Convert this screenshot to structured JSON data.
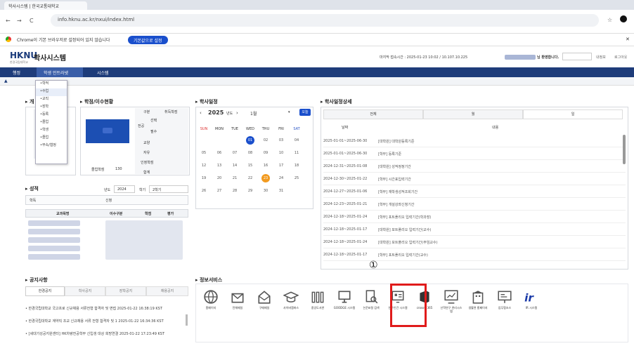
{
  "browser": {
    "tab_title": "학사시스템 | 한국교통대학교",
    "url": "info.hknu.ac.kr/nxui/index.html",
    "back": "←",
    "forward": "→",
    "reload": "C",
    "default_notice": "Chrome이 기본 브라우저로 설정되어 있지 않습니다",
    "set_default_label": "기본값으로 설정"
  },
  "app": {
    "logo": "HKNU",
    "logo_sub": "한경국립대학교",
    "title": "학사시스템",
    "session": "마지막 접속시간 : 2025-01-23 10:02 / 10.107.10.225",
    "greeting": "님 환영합니다.",
    "nav_items": [
      "행정",
      "학생 인트라넷",
      "시스템"
    ],
    "right_links": [
      "내정보",
      "로그아웃"
    ]
  },
  "dropdown_menu": [
    "•학적",
    "•수업",
    "•교직",
    "•장학",
    "•등록",
    "•졸업",
    "•학생",
    "•졸업",
    "•부속/협정"
  ],
  "profile": {
    "title": "개",
    "grad_credit_label": "졸업학점",
    "grad_credit_value": "130"
  },
  "credits": {
    "title": "학점/이수현황",
    "headers": [
      "구분",
      "취득학점"
    ],
    "rows": [
      "전공",
      "선택",
      "필수",
      "교양",
      "자유",
      "인정학점",
      "합계"
    ]
  },
  "grades": {
    "title": "성적",
    "year_label": "년도",
    "year": "2024",
    "term_label": "학기",
    "term": "2학기",
    "major_label": "학독",
    "major_label2": "신청",
    "headers": [
      "교과목명",
      "이수구분",
      "학점",
      "평가"
    ]
  },
  "calendar": {
    "title": "학사일정",
    "year": "2025",
    "year_unit": "년도",
    "month": "1월",
    "today_btn": "오늘",
    "weekdays": [
      "SUN",
      "MON",
      "TUE",
      "WED",
      "THU",
      "FRI",
      "SAT"
    ],
    "weeks": [
      [
        "",
        "",
        "",
        "01",
        "02",
        "03",
        "04"
      ],
      [
        "05",
        "06",
        "07",
        "08",
        "09",
        "10",
        "11"
      ],
      [
        "12",
        "13",
        "14",
        "15",
        "16",
        "17",
        "18"
      ],
      [
        "19",
        "20",
        "21",
        "22",
        "23",
        "24",
        "25"
      ],
      [
        "26",
        "27",
        "28",
        "29",
        "30",
        "31",
        ""
      ]
    ]
  },
  "schedule": {
    "title": "학사일정상세",
    "tabs": [
      "전체",
      "월",
      "일"
    ],
    "headers": [
      "날짜",
      "내용"
    ],
    "rows": [
      {
        "date": "2025-01-01~2025-06-30",
        "text": "[대학원] 대학원등록기준"
      },
      {
        "date": "2025-01-01~2025-06-30",
        "text": "[학부] 등록기준"
      },
      {
        "date": "2024-12-31~2025-01-08",
        "text": "[대학원] 성적정정기간"
      },
      {
        "date": "2024-12-30~2025-01-22",
        "text": "[학부] 시간표입력기간"
      },
      {
        "date": "2024-12-27~2025-01-06",
        "text": "[학부] 재학생성적조회기간"
      },
      {
        "date": "2024-12-23~2025-01-21",
        "text": "[학부] 개설강좌신청기간"
      },
      {
        "date": "2024-12-18~2025-01-24",
        "text": "[학부] 포트폴리오 입력기간(학과장)"
      },
      {
        "date": "2024-12-18~2025-01-17",
        "text": "[대학원] 포트폴리오 입력기간(교수)"
      },
      {
        "date": "2024-12-18~2025-01-24",
        "text": "[대학원] 포트폴리오 입력기간(주임교수)"
      },
      {
        "date": "2024-12-18~2025-01-17",
        "text": "[학부] 포트폴리오 입력기간(교수)"
      }
    ]
  },
  "notices": {
    "title": "공지사항",
    "tabs": [
      "한경공지",
      "학사공지",
      "장학공지",
      "채용공지"
    ],
    "rows": [
      "한경국립대학교 국고프로 신규채용 서류전형 합격자 및 면접 2025-01-22 16:38:19 KST",
      "한경국립대학교 계약직 조교 신규채용 서류 전형 합격자 및 1 2025-01-22 16:34:36 KST",
      "[세대기성공지원센터] HK차량전공학부 신입생 대상 희망연결 2025-01-22 17:23:49 KST"
    ]
  },
  "services": {
    "title": "정보서비스",
    "items": [
      {
        "label": "홈페이지",
        "icon": "globe-icon"
      },
      {
        "label": "전체메일",
        "icon": "mail-icon"
      },
      {
        "label": "구매메일",
        "icon": "mail-open-icon"
      },
      {
        "label": "사이버캠퍼스",
        "icon": "graduation-cap-icon"
      },
      {
        "label": "중앙도서관",
        "icon": "library-icon"
      },
      {
        "label": "GOODGE 시스템",
        "icon": "monitor-icon"
      },
      {
        "label": "논문표절 검색",
        "icon": "document-search-icon"
      },
      {
        "label": "연구인건 시스템",
        "icon": "research-screen-icon"
      },
      {
        "label": "crosoft 365",
        "icon": "office-icon"
      },
      {
        "label": "산학연구 관리시스템",
        "icon": "chart-screen-icon"
      },
      {
        "label": "생활관 홈페이지",
        "icon": "building-icon"
      },
      {
        "label": "업무협조스",
        "icon": "slides-icon"
      },
      {
        "label": "IR 시스템",
        "icon": "ir-logo-icon"
      }
    ]
  },
  "annotation": {
    "marker": "①"
  },
  "colors": {
    "navbar": "#1e3c7a",
    "accent": "#1a4fcc",
    "today": "#f29a1f",
    "highlight": "#e01b1b"
  }
}
